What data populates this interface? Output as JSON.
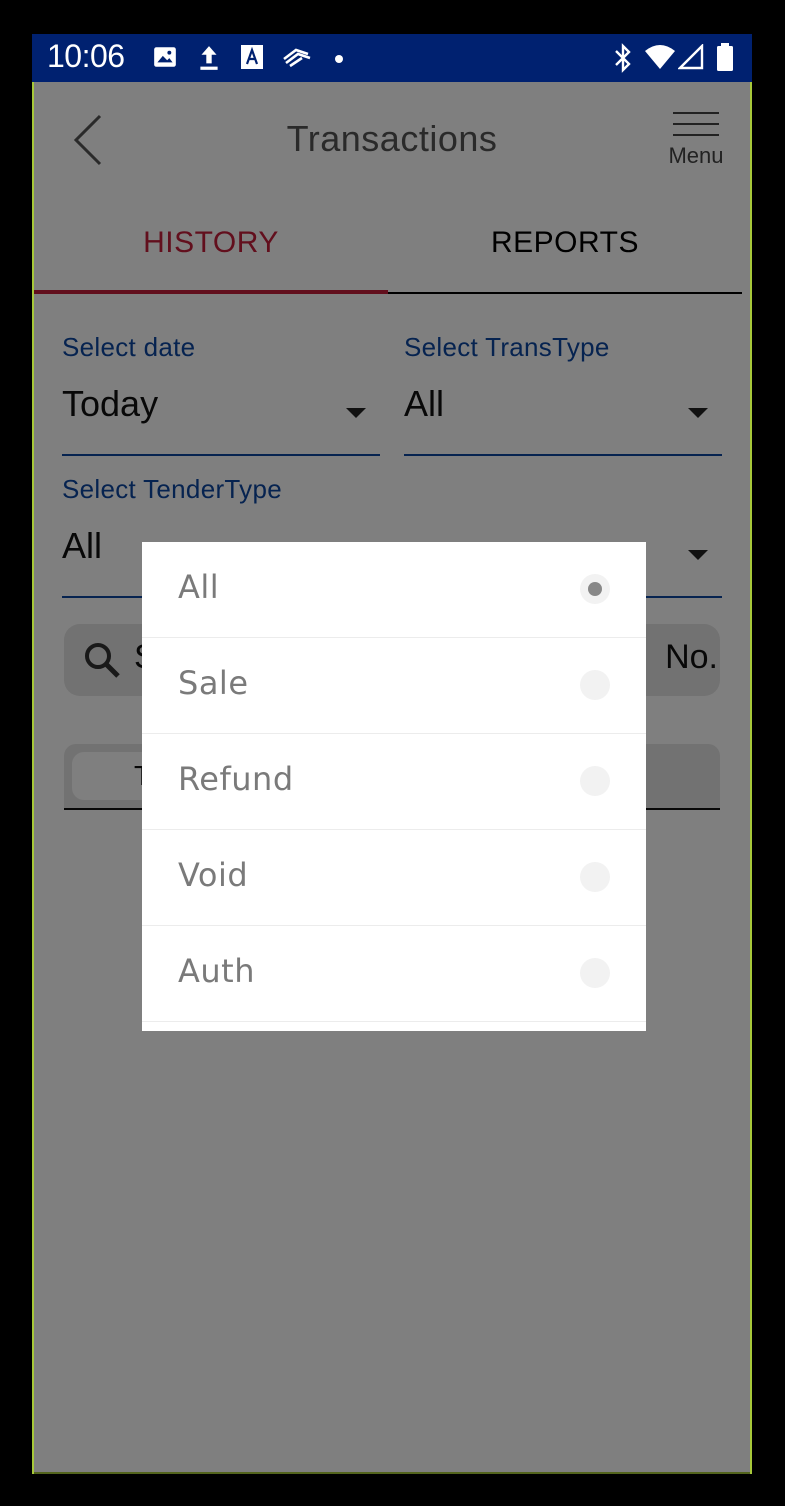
{
  "status_bar": {
    "time": "10:06",
    "left_icons": [
      "image-icon",
      "upload-icon",
      "a-badge-icon",
      "bank-icon",
      "dot-icon"
    ],
    "right_icons": [
      "bluetooth-icon",
      "wifi-icon",
      "signal-icon",
      "battery-icon"
    ]
  },
  "header": {
    "title": "Transactions",
    "back_icon": "chevron-left-icon",
    "menu_label": "Menu"
  },
  "tabs": [
    {
      "label": "HISTORY",
      "active": true
    },
    {
      "label": "REPORTS",
      "active": false
    }
  ],
  "filters": {
    "date": {
      "label": "Select date",
      "value": "Today"
    },
    "trans_type": {
      "label": "Select TransType",
      "value": "All"
    },
    "tender_type": {
      "label": "Select TenderType",
      "value": "All"
    }
  },
  "search": {
    "first_letter": "S",
    "visible_suffix": "No."
  },
  "segment": {
    "first_letter": "T"
  },
  "picker": {
    "options": [
      {
        "label": "All",
        "selected": true
      },
      {
        "label": "Sale",
        "selected": false
      },
      {
        "label": "Refund",
        "selected": false
      },
      {
        "label": "Void",
        "selected": false
      },
      {
        "label": "Auth",
        "selected": false
      }
    ]
  },
  "colors": {
    "status_bar": "#002170",
    "accent_red": "#c41e3a",
    "label_blue": "#0d47a1",
    "frame_green": "#a7c83a"
  }
}
